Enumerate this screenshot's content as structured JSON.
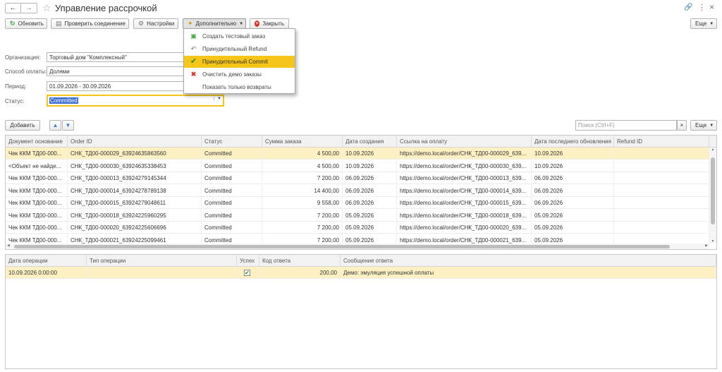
{
  "title": "Управление рассрочкой",
  "toolbar": {
    "refresh": "Обновить",
    "check": "Проверить соединение",
    "settings": "Настройки",
    "more": "Дополнительно",
    "close": "Закрыть",
    "esche": "Еще"
  },
  "menu": {
    "items": [
      {
        "label": "Создать тестовый заказ",
        "icon": "add-doc-icon"
      },
      {
        "label": "Принудительный Refund",
        "icon": "undo-icon"
      },
      {
        "label": "Принудительный Commit",
        "icon": "check-icon"
      },
      {
        "label": "Очистить демо заказы",
        "icon": "delete-icon"
      },
      {
        "label": "Показать только возвраты",
        "icon": ""
      }
    ]
  },
  "form": {
    "org_label": "Организация:",
    "org_value": "Торговый дом \"Комплексный\"",
    "payment_label": "Способ оплаты:",
    "payment_value": "Долями",
    "period_label": "Период:",
    "period_value": "01.09.2026 - 30.09.2026",
    "status_label": "Статус:",
    "status_value": "Committed"
  },
  "list_toolbar": {
    "add": "Добавить",
    "search_placeholder": "Поиск (Ctrl+F)",
    "clear": "×",
    "esche": "Еще"
  },
  "orders": {
    "columns": [
      "Документ основание",
      "Order ID",
      "Статус",
      "Сумма заказа",
      "Дата создания",
      "Ссылка на оплату",
      "Дата последнего обновления",
      "Refund ID"
    ],
    "rows": [
      [
        "Чек ККМ ТД00-000...",
        "СНК_ТД00-000029_63924635863560",
        "Committed",
        "4 500,00",
        "10.09.2026",
        "https://demo.local/order/СНК_ТД00-000029_639...",
        "10.09.2026",
        ""
      ],
      [
        "<Объект не найде...",
        "СНК_ТД00-000030_63924635338453",
        "Committed",
        "4 500,00",
        "10.09.2026",
        "https://demo.local/order/СНК_ТД00-000030_639...",
        "10.09.2026",
        ""
      ],
      [
        "Чек ККМ ТД00-000...",
        "СНК_ТД00-000013_63924279145344",
        "Committed",
        "7 200,00",
        "06.09.2026",
        "https://demo.local/order/СНК_ТД00-000013_639...",
        "06.09.2026",
        ""
      ],
      [
        "Чек ККМ ТД00-000...",
        "СНК_ТД00-000014_63924278789138",
        "Committed",
        "14 400,00",
        "06.09.2026",
        "https://demo.local/order/СНК_ТД00-000014_639...",
        "06.09.2026",
        ""
      ],
      [
        "Чек ККМ ТД00-000...",
        "СНК_ТД00-000015_63924279048611",
        "Committed",
        "9 558,00",
        "06.09.2026",
        "https://demo.local/order/СНК_ТД00-000015_639...",
        "06.09.2026",
        ""
      ],
      [
        "Чек ККМ ТД00-000...",
        "СНК_ТД00-000018_63924225960295",
        "Committed",
        "7 200,00",
        "05.09.2026",
        "https://demo.local/order/СНК_ТД00-000018_639...",
        "05.09.2026",
        ""
      ],
      [
        "Чек ККМ ТД00-000...",
        "СНК_ТД00-000020_63924225606696",
        "Committed",
        "7 200,00",
        "05.09.2026",
        "https://demo.local/order/СНК_ТД00-000020_639...",
        "05.09.2026",
        ""
      ],
      [
        "Чек ККМ ТД00-000...",
        "СНК_ТД00-000021_63924225099461",
        "Committed",
        "7 200,00",
        "05.09.2026",
        "https://demo.local/order/СНК_ТД00-000021_639...",
        "05.09.2026",
        ""
      ]
    ]
  },
  "operations": {
    "columns": [
      "Дата операции",
      "Тип операции",
      "Успех",
      "Код ответа",
      "Сообщение ответа"
    ],
    "rows": [
      [
        "10.09.2026 0:00:00",
        "",
        "✔",
        "200,00",
        "Демо: эмуляция успешной оплаты"
      ]
    ]
  },
  "colors": {
    "accent": "#f5c518",
    "selected_row": "#fdf0c2",
    "check_green": "#3ea63e",
    "close_red": "#d9372b"
  }
}
